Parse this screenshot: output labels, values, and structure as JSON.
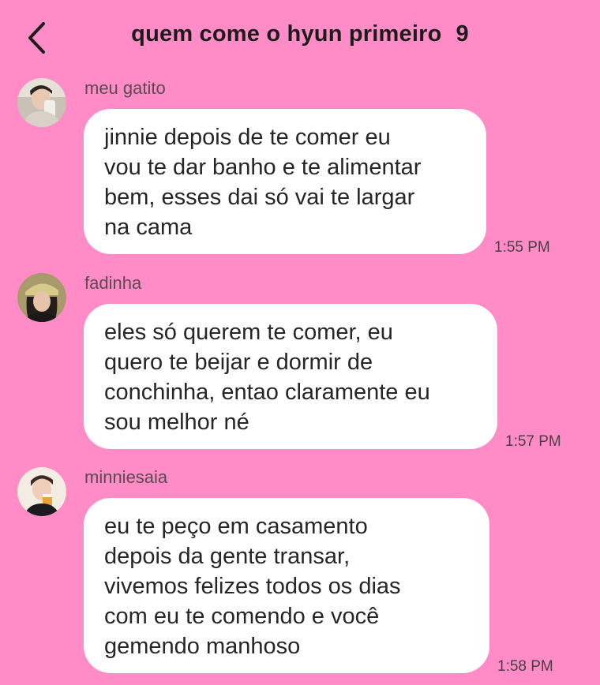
{
  "header": {
    "title": "quem come o hyun primeiro",
    "member_count": "9",
    "back_icon": "chevron-left-icon"
  },
  "messages": [
    {
      "sender": "meu gatito",
      "lines": [
        "jinnie depois de te comer eu",
        "vou te dar banho e te alimentar",
        "bem, esses dai só vai te largar",
        "na cama"
      ],
      "time": "1:55 PM"
    },
    {
      "sender": "fadinha",
      "lines": [
        "eles só querem te comer, eu",
        "quero te beijar e dormir de",
        "conchinha, entao claramente eu",
        "sou melhor né"
      ],
      "time": "1:57 PM"
    },
    {
      "sender": "minniesaia",
      "lines": [
        "eu te peço em casamento",
        "depois da gente transar,",
        "vivemos felizes todos os dias",
        "com eu te comendo e você",
        "gemendo manhoso"
      ],
      "time": "1:58 PM"
    }
  ],
  "colors": {
    "background": "#ff8cc6",
    "bubble": "#ffffff",
    "text": "#262626",
    "sender": "#5b4a52"
  }
}
